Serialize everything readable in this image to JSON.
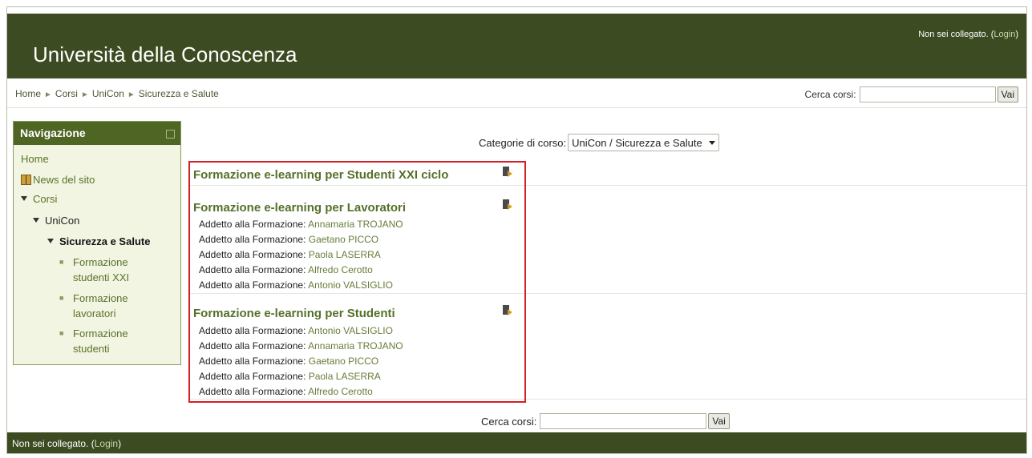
{
  "header": {
    "site_title": "Università della Conoscenza",
    "login_prefix": "Non sei collegato. (",
    "login_link": "Login",
    "login_suffix": ")"
  },
  "breadcrumb": [
    {
      "label": "Home"
    },
    {
      "label": "Corsi"
    },
    {
      "label": "UniCon"
    },
    {
      "label": "Sicurezza e Salute"
    }
  ],
  "search_top": {
    "label": "Cerca corsi:",
    "value": "",
    "button": "Vai"
  },
  "navigation": {
    "title": "Navigazione",
    "home": "Home",
    "news": "News del sito",
    "corsi": "Corsi",
    "unicon": "UniCon",
    "current": "Sicurezza e Salute",
    "sub_items": [
      {
        "line1": "Formazione",
        "line2": "studenti XXI"
      },
      {
        "line1": "Formazione",
        "line2": "lavoratori"
      },
      {
        "line1": "Formazione",
        "line2": "studenti"
      }
    ]
  },
  "category": {
    "label": "Categorie di corso:",
    "selected": "UniCon / Sicurezza e Salute"
  },
  "role_label": "Addetto alla Formazione",
  "courses": [
    {
      "title": "Formazione e-learning per Studenti XXI ciclo",
      "teachers": []
    },
    {
      "title": "Formazione e-learning per Lavoratori",
      "teachers": [
        "Annamaria TROJANO",
        "Gaetano PICCO",
        "Paola LASERRA",
        "Alfredo Cerotto",
        "Antonio VALSIGLIO"
      ]
    },
    {
      "title": "Formazione e-learning per Studenti",
      "teachers": [
        "Antonio VALSIGLIO",
        "Annamaria TROJANO",
        "Gaetano PICCO",
        "Paola LASERRA",
        "Alfredo Cerotto"
      ]
    }
  ],
  "search_bottom": {
    "label": "Cerca corsi:",
    "value": "",
    "button": "Vai"
  },
  "footer": {
    "login_prefix": "Non sei collegato. (",
    "login_link": "Login",
    "login_suffix": ")"
  }
}
